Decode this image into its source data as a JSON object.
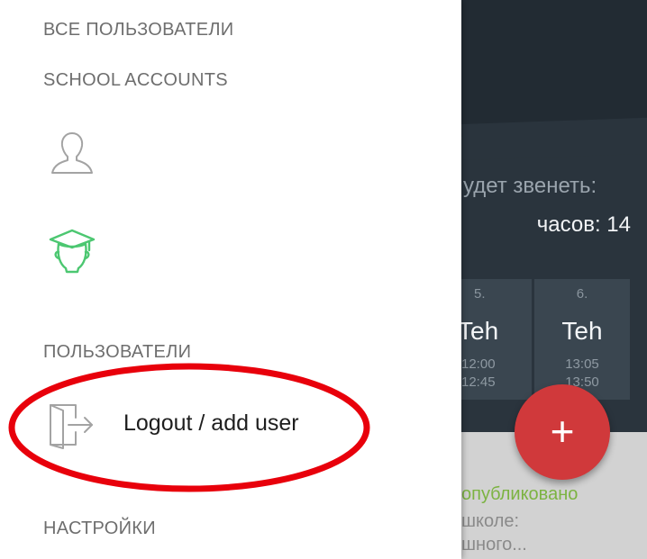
{
  "drawer": {
    "sections": {
      "all_users": "ВСЕ ПОЛЬЗОВАТЕЛИ",
      "school_accounts": "SCHOOL ACCOUNTS",
      "users": "ПОЛЬЗОВАТЕЛИ",
      "settings": "НАСТРОЙКИ"
    },
    "accounts": [
      {
        "icon": "person-outline-icon",
        "color": "#9e9e9e"
      },
      {
        "icon": "graduate-cap-icon",
        "color": "#4cc771"
      }
    ],
    "logout": {
      "icon": "logout-icon",
      "label": "Logout / add user"
    }
  },
  "background_app": {
    "ring_info": {
      "line1": "удет звенеть:",
      "line2": "часов: 14"
    },
    "lessons": [
      {
        "number": "5.",
        "subject": "Teh",
        "start": "12:00",
        "end": "12:45"
      },
      {
        "number": "6.",
        "subject": "Teh",
        "start": "13:05",
        "end": "13:50"
      }
    ],
    "feed": {
      "status": "опубликовано",
      "line1": "школе:",
      "line2": "шного..."
    },
    "fab_label": "+"
  },
  "colors": {
    "accent_green": "#4cc771",
    "fab_red": "#d0393b",
    "header_dark": "#2a343d",
    "annotation_red": "#e8000b"
  }
}
